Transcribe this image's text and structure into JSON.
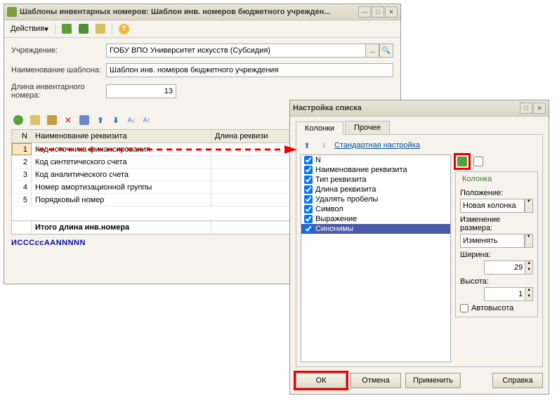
{
  "main_window": {
    "title": "Шаблоны инвентарных номеров: Шаблон инв. номеров бюджетного учрежден...",
    "actions_label": "Действия",
    "labels": {
      "institution": "Учреждение:",
      "template_name": "Наименование шаблона:",
      "inv_length": "Длина инвентарного номера:"
    },
    "values": {
      "institution": "ГОБУ ВПО Университет искусств (Субсидия)",
      "template_name": "Шаблон инв. номеров бюджетного учреждения",
      "inv_length": "13"
    },
    "grid": {
      "headers": {
        "n": "N",
        "name": "Наименование реквизита",
        "len": "Длина реквизи"
      },
      "rows": [
        {
          "n": "1",
          "name": "Код источника финансирования"
        },
        {
          "n": "2",
          "name": "Код синтетического счета"
        },
        {
          "n": "3",
          "name": "Код аналитического счета"
        },
        {
          "n": "4",
          "name": "Номер амортизационной группы"
        },
        {
          "n": "5",
          "name": "Порядковый номер"
        }
      ],
      "footer": "Итого длина инв.номера"
    },
    "pattern": "ИСССссААNNNNN"
  },
  "dialog": {
    "title": "Настройка списка",
    "tabs": {
      "columns": "Колонки",
      "other": "Прочее"
    },
    "standard_link": "Стандартная настройка",
    "check_items": [
      "N",
      "Наименование реквизита",
      "Тип реквизита",
      "Длина реквизита",
      "Удалять пробелы",
      "Символ",
      "Выражение",
      "Синонимы"
    ],
    "selected_item": "Синонимы",
    "fieldset_title": "Колонка",
    "labels": {
      "position": "Положение:",
      "resize": "Изменение размера:",
      "width": "Ширина:",
      "height": "Высота:",
      "autoheight": "Автовысота"
    },
    "values": {
      "position": "Новая колонка",
      "resize": "Изменять",
      "width": "29",
      "height": "1"
    },
    "buttons": {
      "ok": "ОК",
      "cancel": "Отмена",
      "apply": "Применить",
      "help": "Справка"
    }
  }
}
